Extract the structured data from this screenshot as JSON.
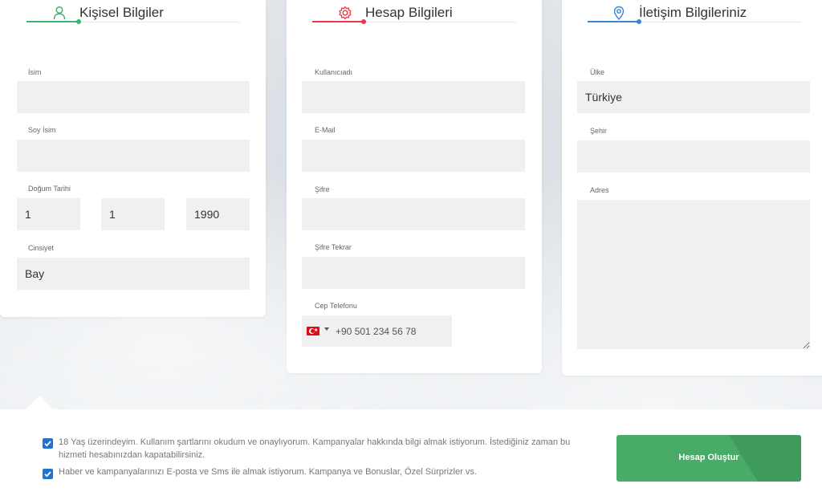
{
  "colors": {
    "green": "#3cb371",
    "red": "#f0354b",
    "blue": "#3a86d0",
    "button": "#49ab68",
    "checkbox": "#1e73d1"
  },
  "personal": {
    "title": "Kişisel Bilgiler",
    "icon": "user-icon",
    "name_label": "İsim",
    "name_value": "",
    "surname_label": "Soy İsim",
    "surname_value": "",
    "dob_label": "Doğum Tarihi",
    "dob_day": "1",
    "dob_month": "1",
    "dob_year": "1990",
    "gender_label": "Cinsiyet",
    "gender_value": "Bay"
  },
  "account": {
    "title": "Hesap Bilgileri",
    "icon": "gear-icon",
    "username_label": "Kullanıcıadı",
    "username_value": "",
    "email_label": "E-Mail",
    "email_value": "",
    "password_label": "Şifre",
    "password_value": "",
    "password_repeat_label": "Şifre Tekrar",
    "password_repeat_value": "",
    "phone_label": "Cep Telefonu",
    "phone_placeholder": "+90 501 234 56 78",
    "phone_flag": "turkey-flag-icon"
  },
  "contact": {
    "title": "İletişim Bilgileriniz",
    "icon": "location-pin-icon",
    "country_label": "Ülke",
    "country_value": "Türkiye",
    "city_label": "Şehir",
    "city_value": "",
    "address_label": "Adres",
    "address_value": ""
  },
  "footer": {
    "terms_text_line1": "18 Yaş üzerindeyim. Kullanım şartlarını okudum ve onaylıyorum. Kampanyalar hakkında bilgi almak istiyorum. İstediğiniz zaman bu",
    "terms_text_line2": "hizmeti hesabınızdan kapatabilirsiniz.",
    "terms_checked": true,
    "marketing_text": "Haber ve kampanyalarınızı E-posta ve Sms ile almak istiyorum. Kampanya ve Bonuslar, Özel Sürprizler vs.",
    "marketing_checked": true,
    "create_button": "Hesap Oluştur"
  }
}
